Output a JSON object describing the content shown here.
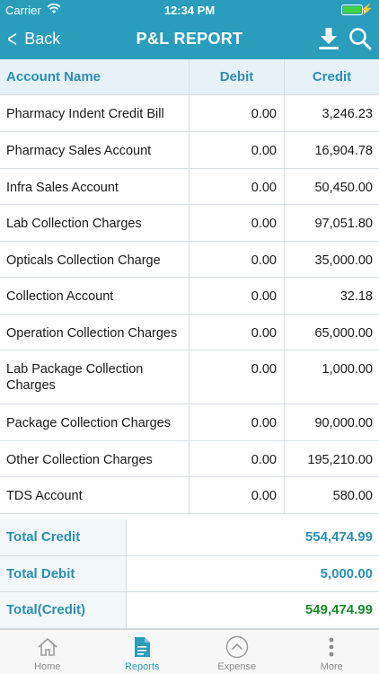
{
  "status_bar": {
    "carrier": "Carrier",
    "time": "12:34 PM"
  },
  "nav": {
    "back_label": "Back",
    "title": "P&L REPORT",
    "icons": [
      "download-icon",
      "search-icon"
    ]
  },
  "table": {
    "headers": {
      "account": "Account Name",
      "debit": "Debit",
      "credit": "Credit"
    },
    "rows": [
      {
        "name": "Pharmacy Indent Credit Bill",
        "debit": "0.00",
        "credit": "3,246.23"
      },
      {
        "name": "Pharmacy Sales Account",
        "debit": "0.00",
        "credit": "16,904.78"
      },
      {
        "name": "Infra Sales Account",
        "debit": "0.00",
        "credit": "50,450.00"
      },
      {
        "name": "Lab Collection Charges",
        "debit": "0.00",
        "credit": "97,051.80"
      },
      {
        "name": "Opticals Collection Charge",
        "debit": "0.00",
        "credit": "35,000.00"
      },
      {
        "name": "Collection Account",
        "debit": "0.00",
        "credit": "32.18"
      },
      {
        "name": "Operation Collection Charges",
        "debit": "0.00",
        "credit": "65,000.00"
      },
      {
        "name": "Lab Package Collection Charges",
        "debit": "0.00",
        "credit": "1,000.00"
      },
      {
        "name": "Package Collection Charges",
        "debit": "0.00",
        "credit": "90,000.00"
      },
      {
        "name": "Other Collection Charges",
        "debit": "0.00",
        "credit": "195,210.00"
      },
      {
        "name": "TDS Account",
        "debit": "0.00",
        "credit": "580.00"
      }
    ]
  },
  "totals": {
    "credit_label": "Total Credit",
    "credit_value": "554,474.99",
    "debit_label": "Total Debit",
    "debit_value": "5,000.00",
    "net_label": "Total(Credit)",
    "net_value": "549,474.99"
  },
  "tabs": [
    {
      "label": "Home",
      "icon": "home-icon"
    },
    {
      "label": "Reports",
      "icon": "document-icon"
    },
    {
      "label": "Expense",
      "icon": "chevron-up-circle-icon"
    },
    {
      "label": "More",
      "icon": "more-vertical-icon"
    }
  ],
  "colors": {
    "header": "#2a9dbd",
    "accent": "#2a8fb1",
    "net_total": "#1a8a2a",
    "active_tab": "#2a9dbd"
  }
}
